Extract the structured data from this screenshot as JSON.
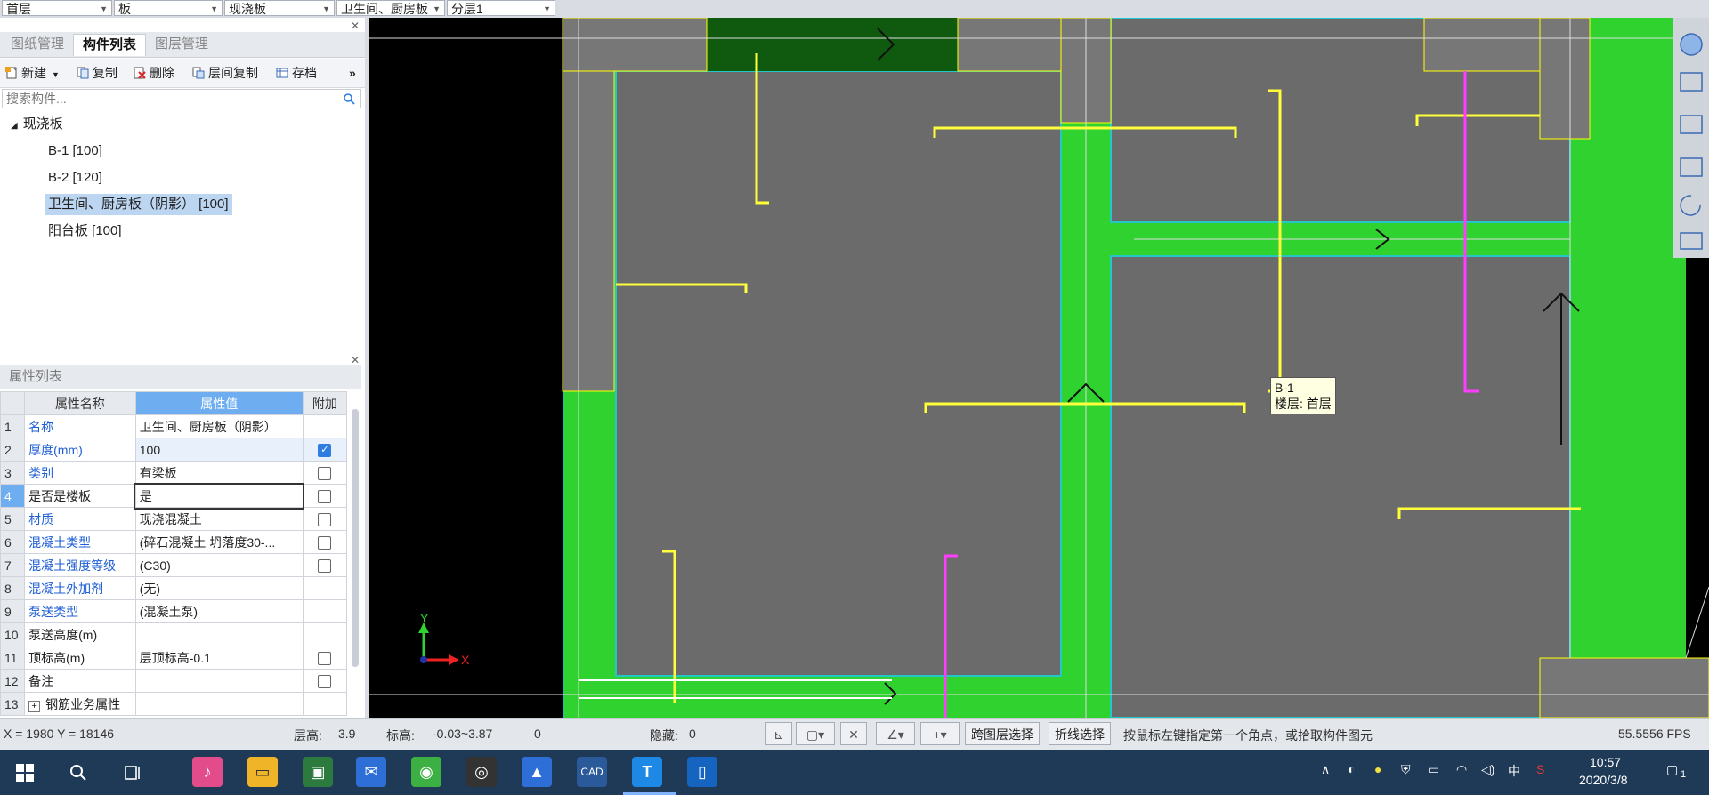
{
  "topbar": {
    "floor": "首层",
    "type": "板",
    "subtype": "现浇板",
    "component": "卫生间、厨房板",
    "layer": "分层1"
  },
  "left_panel": {
    "tabs": [
      "图纸管理",
      "构件列表",
      "图层管理"
    ],
    "active_tab": "构件列表",
    "toolbar": {
      "new": "新建",
      "copy": "复制",
      "delete": "删除",
      "floor_copy": "层间复制",
      "save": "存档",
      "more": "»"
    },
    "search_placeholder": "搜索构件...",
    "tree": {
      "root": "现浇板",
      "items": [
        "B-1 [100]",
        "B-2 [120]",
        "卫生间、厨房板（阴影） [100]",
        "阳台板 [100]"
      ],
      "selected_index": 2
    }
  },
  "properties": {
    "title": "属性列表",
    "headers": [
      "属性名称",
      "属性值",
      "附加"
    ],
    "rows": [
      {
        "n": "1",
        "name": "名称",
        "value": "卫生间、厨房板（阴影）",
        "check": null,
        "blue": true
      },
      {
        "n": "2",
        "name": "厚度(mm)",
        "value": "100",
        "check": true,
        "blue": true
      },
      {
        "n": "3",
        "name": "类别",
        "value": "有梁板",
        "check": false,
        "blue": true
      },
      {
        "n": "4",
        "name": "是否是楼板",
        "value": "是",
        "check": false,
        "blue": false
      },
      {
        "n": "5",
        "name": "材质",
        "value": "现浇混凝土",
        "check": false,
        "blue": true
      },
      {
        "n": "6",
        "name": "混凝土类型",
        "value": "(碎石混凝土 坍落度30-...",
        "check": false,
        "blue": true
      },
      {
        "n": "7",
        "name": "混凝土强度等级",
        "value": "(C30)",
        "check": false,
        "blue": true
      },
      {
        "n": "8",
        "name": "混凝土外加剂",
        "value": "(无)",
        "check": null,
        "blue": true
      },
      {
        "n": "9",
        "name": "泵送类型",
        "value": "(混凝土泵)",
        "check": null,
        "blue": true
      },
      {
        "n": "10",
        "name": "泵送高度(m)",
        "value": "",
        "check": null,
        "blue": false
      },
      {
        "n": "11",
        "name": "顶标高(m)",
        "value": "层顶标高-0.1",
        "check": false,
        "blue": false
      },
      {
        "n": "12",
        "name": "备注",
        "value": "",
        "check": false,
        "blue": false
      },
      {
        "n": "13",
        "name": "钢筋业务属性",
        "value": "",
        "check": null,
        "blue": false
      }
    ],
    "current_row": "4"
  },
  "canvas": {
    "tooltip_line1": "B-1",
    "tooltip_line2": "楼层: 首层",
    "axis_x": "X",
    "axis_y": "Y"
  },
  "status": {
    "coords": "X = 1980 Y = 18146",
    "floor_height_label": "层高:",
    "floor_height": "3.9",
    "elev_label": "标高:",
    "elev": "-0.03~3.87",
    "zero": "0",
    "hidden_label": "隐藏:",
    "hidden": "0",
    "cross_layer": "跨图层选择",
    "polyline": "折线选择",
    "hint": "按鼠标左键指定第一个角点，或拾取构件图元",
    "fps": "55.5556 FPS"
  },
  "taskbar": {
    "lang": "中",
    "time": "10:57",
    "date": "2020/3/8",
    "notif": "1"
  },
  "colors": {
    "slab_gray": "#6b6b6b",
    "beam_green": "#2fd22f",
    "dark_green": "#0f5a0f",
    "rebar_yellow": "#ffff3c",
    "rebar_magenta": "#ff3cff",
    "accent_blue": "#6eaef0"
  }
}
